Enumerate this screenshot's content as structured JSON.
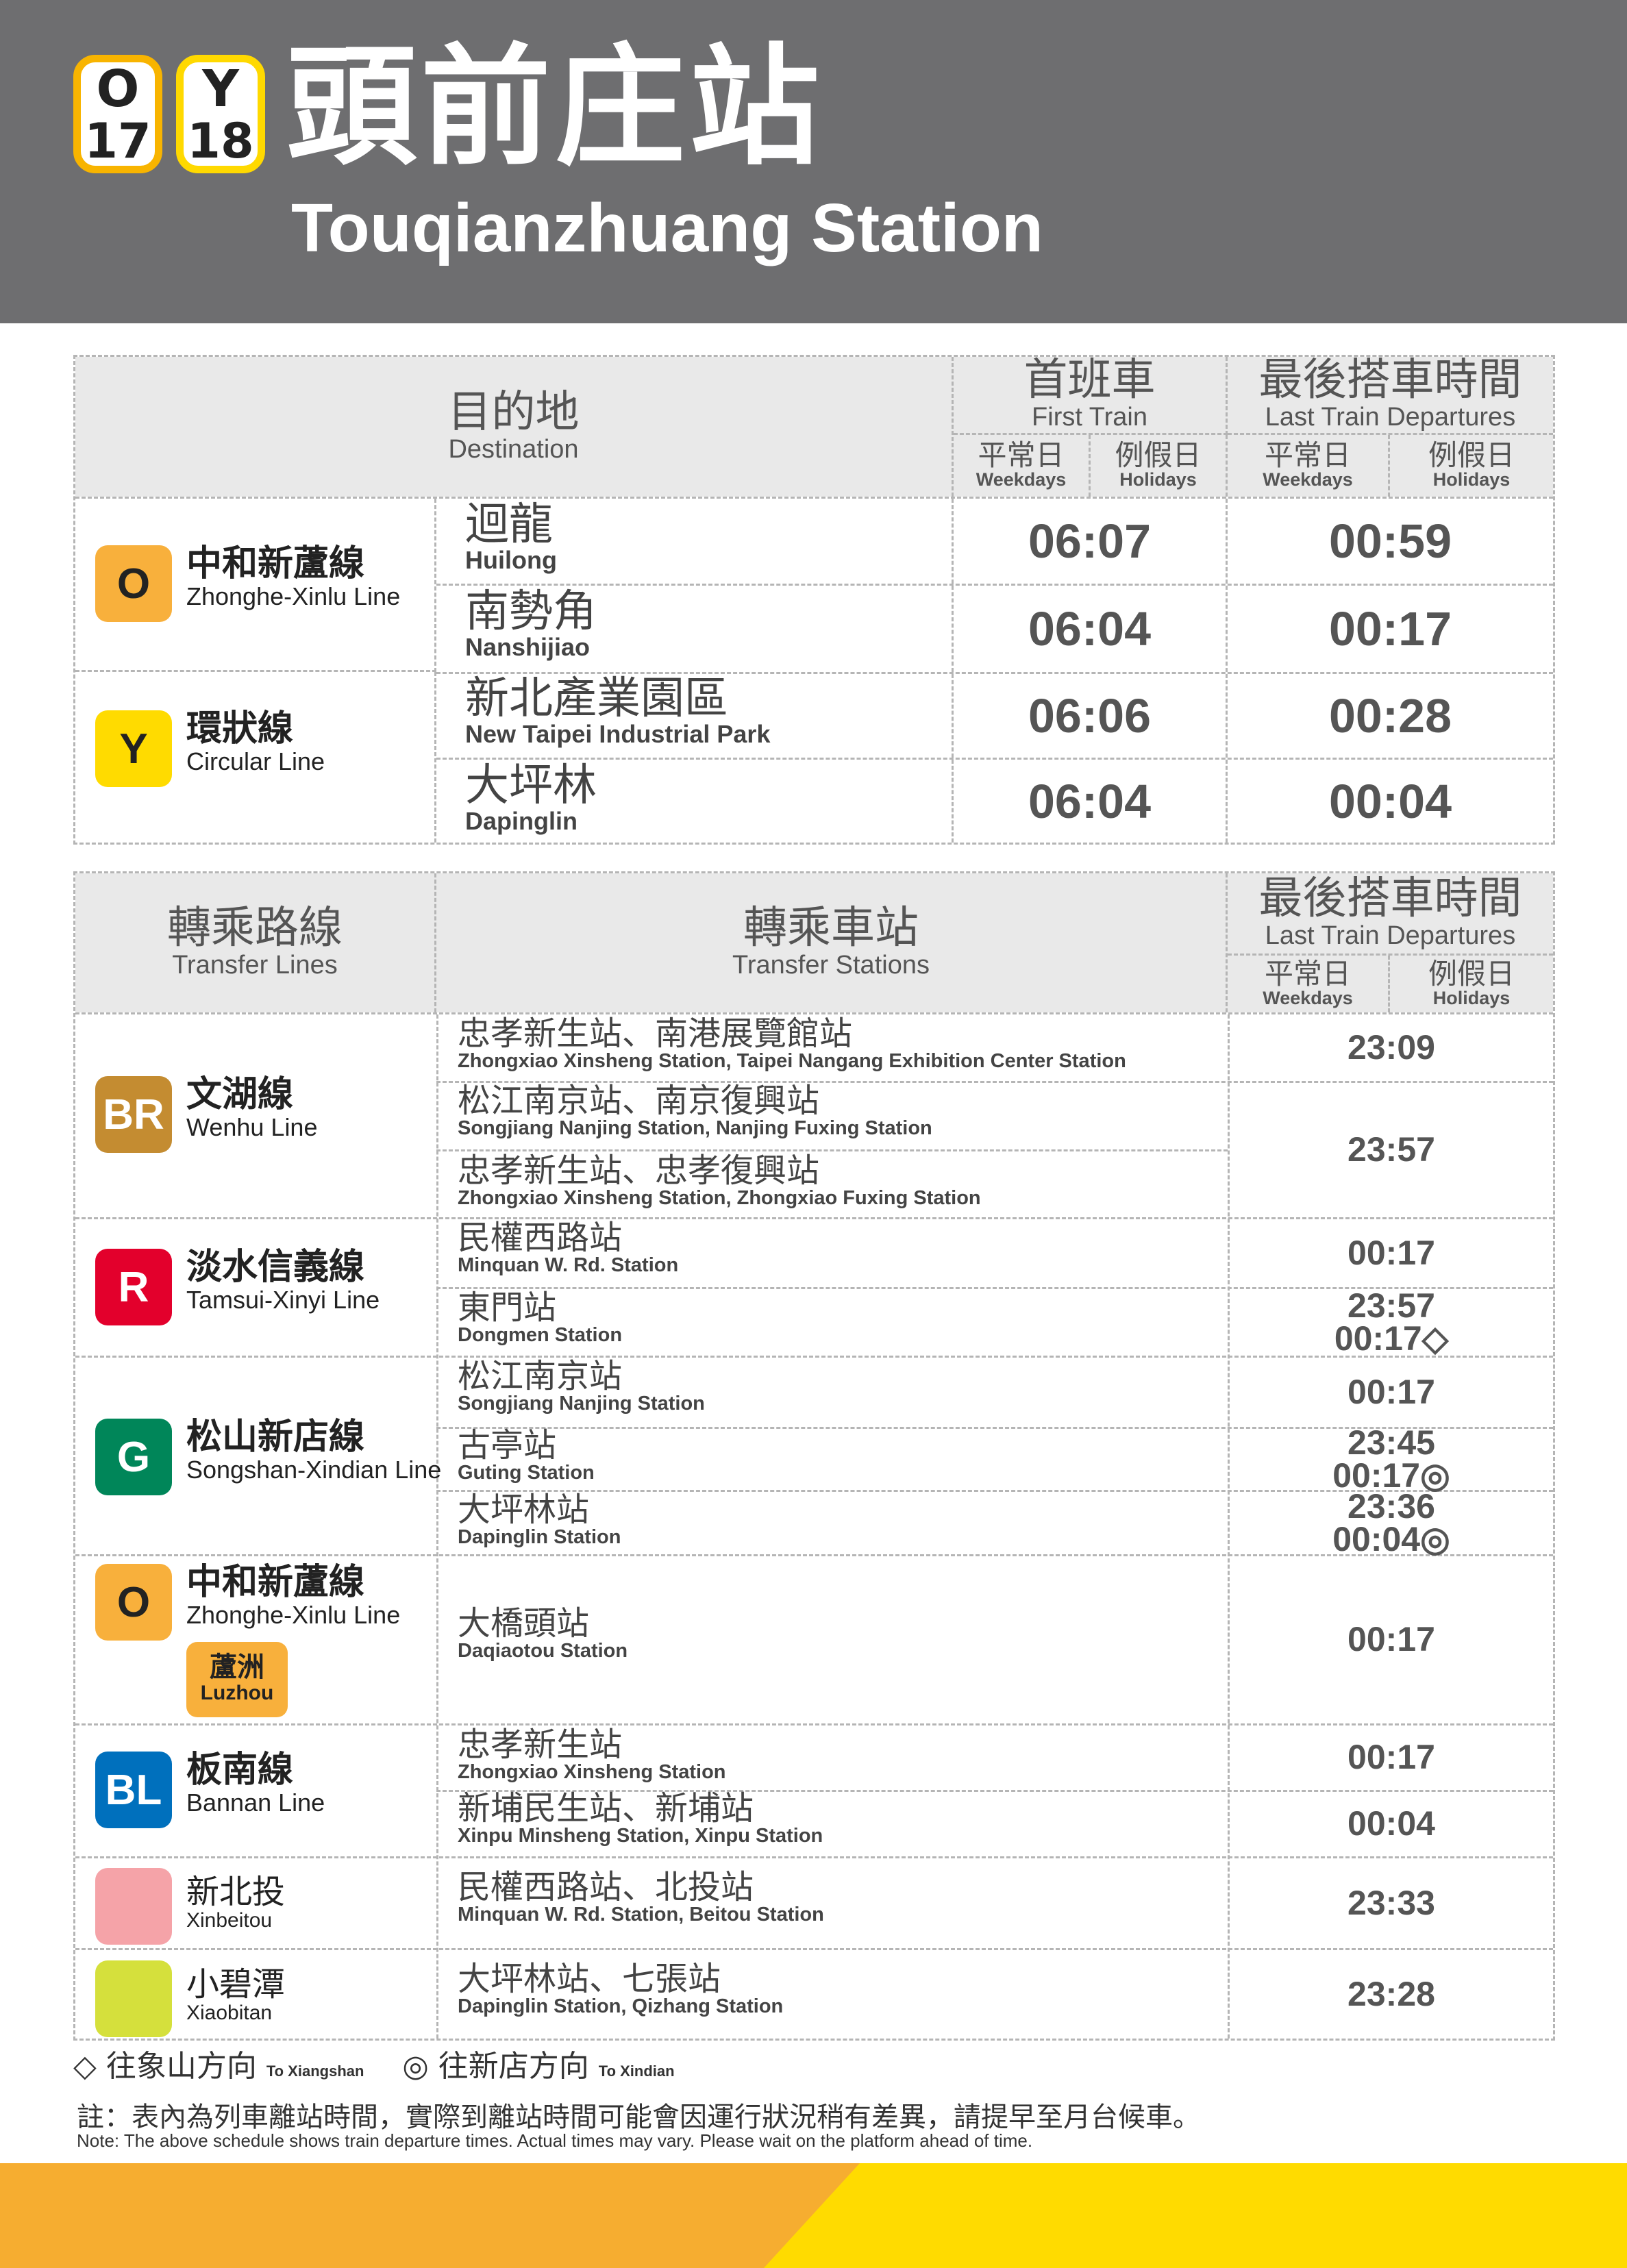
{
  "header": {
    "badges": [
      {
        "letter": "O",
        "number": "17",
        "color": "#f8b400"
      },
      {
        "letter": "Y",
        "number": "18",
        "color": "#ffd900"
      }
    ],
    "station_zh": "頭前庄站",
    "station_en": "Touqianzhuang Station"
  },
  "table1": {
    "destination_zh": "目的地",
    "destination_en": "Destination",
    "first_zh": "首班車",
    "first_en": "First Train",
    "last_zh": "最後搭車時間",
    "last_en": "Last Train Departures",
    "weekdays_zh": "平常日",
    "weekdays_en": "Weekdays",
    "holidays_zh": "例假日",
    "holidays_en": "Holidays",
    "lines": [
      {
        "code": "O",
        "color": "#f8b03c",
        "name_zh": "中和新蘆線",
        "name_en": "Zhonghe-Xinlu Line"
      },
      {
        "code": "Y",
        "color": "#ffdb00",
        "name_zh": "環狀線",
        "name_en": "Circular Line"
      }
    ],
    "rows": [
      {
        "dest_zh": "迴龍",
        "dest_en": "Huilong",
        "first": "06:07",
        "last": "00:59"
      },
      {
        "dest_zh": "南勢角",
        "dest_en": "Nanshijiao",
        "first": "06:04",
        "last": "00:17"
      },
      {
        "dest_zh": "新北產業園區",
        "dest_en": "New Taipei Industrial Park",
        "first": "06:06",
        "last": "00:28"
      },
      {
        "dest_zh": "大坪林",
        "dest_en": "Dapinglin",
        "first": "06:04",
        "last": "00:04"
      }
    ]
  },
  "table2": {
    "lines_zh": "轉乘路線",
    "lines_en": "Transfer Lines",
    "stations_zh": "轉乘車站",
    "stations_en": "Transfer Stations",
    "last_zh": "最後搭車時間",
    "last_en": "Last Train Departures",
    "weekdays_zh": "平常日",
    "weekdays_en": "Weekdays",
    "holidays_zh": "例假日",
    "holidays_en": "Holidays",
    "lines": [
      {
        "code": "BR",
        "color": "#c48c31",
        "text_color": "#ffffff",
        "name_zh": "文湖線",
        "name_en": "Wenhu Line"
      },
      {
        "code": "R",
        "color": "#e3002c",
        "text_color": "#ffffff",
        "name_zh": "淡水信義線",
        "name_en": "Tamsui-Xinyi Line"
      },
      {
        "code": "G",
        "color": "#008659",
        "text_color": "#ffffff",
        "name_zh": "松山新店線",
        "name_en": "Songshan-Xindian Line"
      },
      {
        "code": "O",
        "color": "#f8b03c",
        "text_color": "#222222",
        "name_zh": "中和新蘆線",
        "name_en": "Zhonghe-Xinlu Line",
        "branch_zh": "蘆洲",
        "branch_en": "Luzhou"
      },
      {
        "code": "BL",
        "color": "#0070bd",
        "text_color": "#ffffff",
        "name_zh": "板南線",
        "name_en": "Bannan Line"
      },
      {
        "code": "",
        "color": "#f5a3a8",
        "text_color": "#222222",
        "name_zh": "新北投",
        "name_en": "Xinbeitou"
      },
      {
        "code": "",
        "color": "#d5e03c",
        "text_color": "#222222",
        "name_zh": "小碧潭",
        "name_en": "Xiaobitan"
      }
    ],
    "stations": [
      {
        "zh": "忠孝新生站、南港展覽館站",
        "en": "Zhongxiao Xinsheng Station, Taipei Nangang Exhibition Center Station"
      },
      {
        "zh": "松江南京站、南京復興站",
        "en": "Songjiang Nanjing Station, Nanjing Fuxing Station"
      },
      {
        "zh": "忠孝新生站、忠孝復興站",
        "en": "Zhongxiao Xinsheng Station, Zhongxiao Fuxing Station"
      },
      {
        "zh": "民權西路站",
        "en": "Minquan W. Rd. Station"
      },
      {
        "zh": "東門站",
        "en": "Dongmen Station"
      },
      {
        "zh": "松江南京站",
        "en": "Songjiang Nanjing Station"
      },
      {
        "zh": "古亭站",
        "en": "Guting Station"
      },
      {
        "zh": "大坪林站",
        "en": "Dapinglin Station"
      },
      {
        "zh": "大橋頭站",
        "en": "Daqiaotou Station"
      },
      {
        "zh": "忠孝新生站",
        "en": "Zhongxiao Xinsheng Station"
      },
      {
        "zh": "新埔民生站、新埔站",
        "en": "Xinpu Minsheng Station, Xinpu Station"
      },
      {
        "zh": "民權西路站、北投站",
        "en": "Minquan W. Rd. Station, Beitou Station"
      },
      {
        "zh": "大坪林站、七張站",
        "en": "Dapinglin Station, Qizhang Station"
      }
    ],
    "times": [
      {
        "lines": [
          "23:09"
        ]
      },
      {
        "lines": [
          "23:57"
        ]
      },
      {
        "lines": [
          "00:17"
        ]
      },
      {
        "lines": [
          "23:57",
          "00:17◇"
        ]
      },
      {
        "lines": [
          "00:17"
        ]
      },
      {
        "lines": [
          "23:45",
          "00:17◎"
        ]
      },
      {
        "lines": [
          "23:36",
          "00:04◎"
        ]
      },
      {
        "lines": [
          "00:17"
        ]
      },
      {
        "lines": [
          "00:17"
        ]
      },
      {
        "lines": [
          "00:04"
        ]
      },
      {
        "lines": [
          "23:33"
        ]
      },
      {
        "lines": [
          "23:28"
        ]
      }
    ]
  },
  "legend": {
    "diamond": "◇ 往象山方向",
    "diamond_en": "To Xiangshan",
    "circle": "◎ 往新店方向",
    "circle_en": "To Xindian"
  },
  "notes": {
    "zh": "註：表內為列車離站時間，實際到離站時間可能會因運行狀況稍有差異，請提早至月台候車。",
    "en": "Note: The above schedule shows train departure times. Actual times may vary. Please wait on the platform ahead of time."
  },
  "colors": {
    "header_bg": "#6e6e70",
    "table_header_bg": "#e9e9e9",
    "footer_orange": "#f6ad30",
    "footer_yellow": "#ffdb00"
  }
}
